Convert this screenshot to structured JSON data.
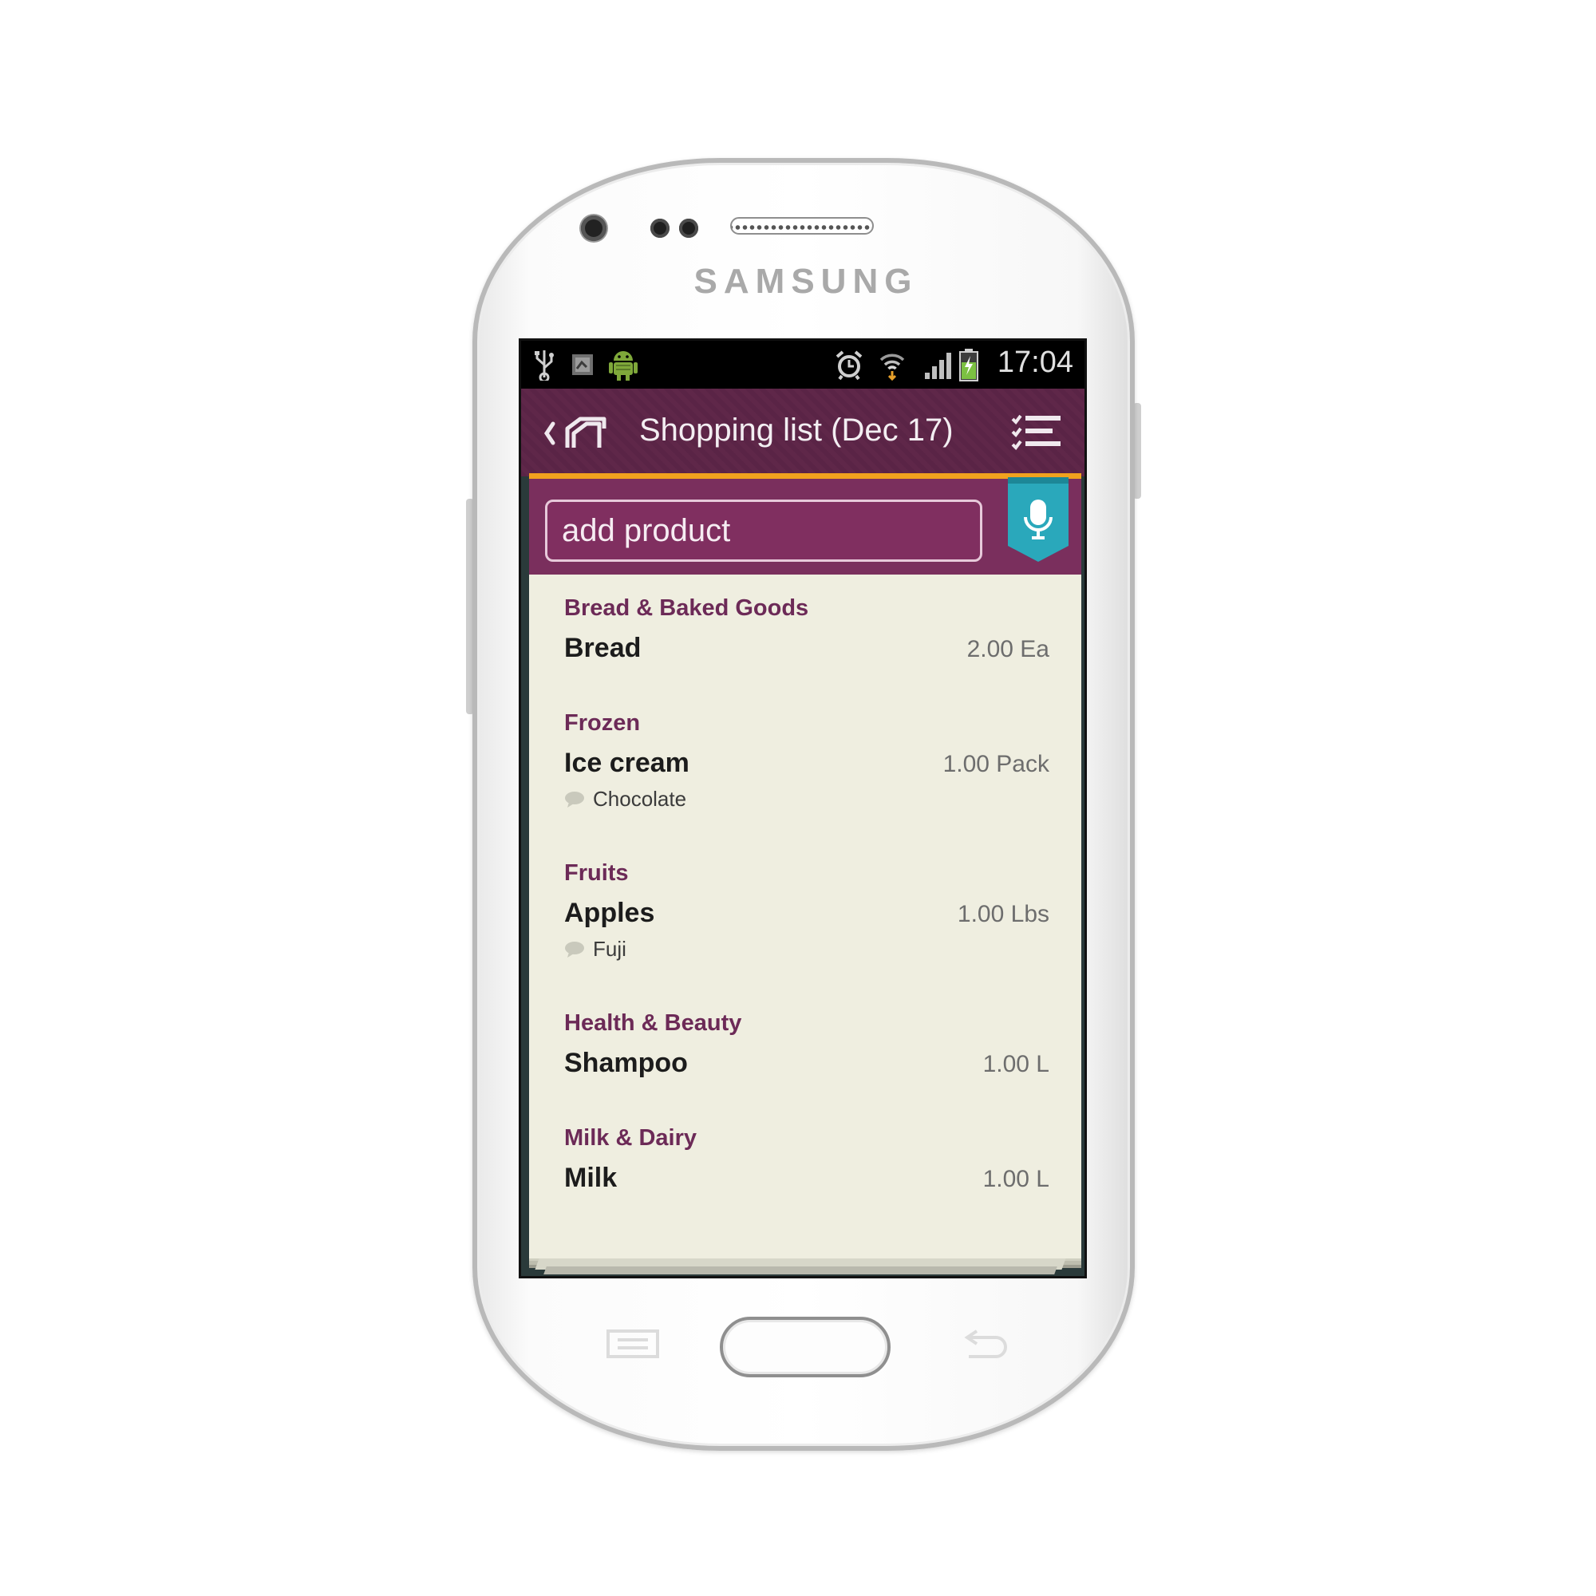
{
  "device": {
    "brand": "SAMSUNG"
  },
  "statusbar": {
    "time": "17:04"
  },
  "actionbar": {
    "title": "Shopping list (Dec 17)"
  },
  "input": {
    "placeholder": "add product"
  },
  "colors": {
    "accent": "#6c2a57",
    "actionbar": "#5d2648",
    "divider": "#f1a21e",
    "mic": "#2aa8bb",
    "paper": "#efeee0"
  },
  "sections": [
    {
      "category": "Bread & Baked Goods",
      "items": [
        {
          "name": "Bread",
          "qty": "2.00 Ea"
        }
      ]
    },
    {
      "category": "Frozen",
      "items": [
        {
          "name": "Ice cream",
          "qty": "1.00 Pack",
          "note": "Chocolate"
        }
      ]
    },
    {
      "category": "Fruits",
      "items": [
        {
          "name": "Apples",
          "qty": "1.00 Lbs",
          "note": "Fuji"
        }
      ]
    },
    {
      "category": "Health & Beauty",
      "items": [
        {
          "name": "Shampoo",
          "qty": "1.00 L"
        }
      ]
    },
    {
      "category": "Milk & Dairy",
      "items": [
        {
          "name": "Milk",
          "qty": "1.00 L"
        }
      ]
    }
  ]
}
